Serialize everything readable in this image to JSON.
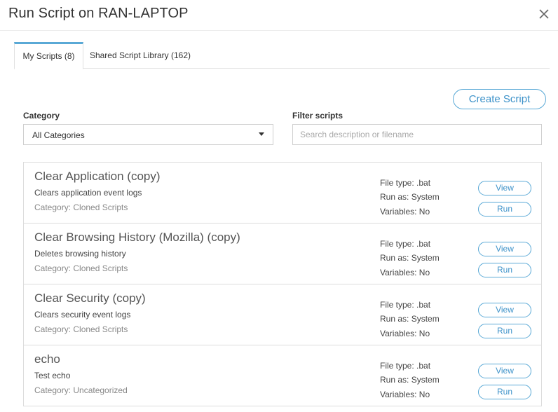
{
  "dialog": {
    "title": "Run Script on RAN-LAPTOP"
  },
  "tabs": [
    {
      "label": "My Scripts (8)",
      "active": true
    },
    {
      "label": "Shared Script Library (162)",
      "active": false
    }
  ],
  "actions": {
    "create_label": "Create Script"
  },
  "filters": {
    "category_label": "Category",
    "category_value": "All Categories",
    "filter_label": "Filter scripts",
    "filter_placeholder": "Search description or filename",
    "filter_value": ""
  },
  "scripts": [
    {
      "name": "Clear Application (copy)",
      "description": "Clears application event logs",
      "category": "Category: Cloned Scripts",
      "file_type": "File type: .bat",
      "run_as": "Run as: System",
      "variables": "Variables: No",
      "view_label": "View",
      "run_label": "Run"
    },
    {
      "name": "Clear Browsing History (Mozilla) (copy)",
      "description": "Deletes browsing history",
      "category": "Category: Cloned Scripts",
      "file_type": "File type: .bat",
      "run_as": "Run as: System",
      "variables": "Variables: No",
      "view_label": "View",
      "run_label": "Run"
    },
    {
      "name": "Clear Security (copy)",
      "description": "Clears security event logs",
      "category": "Category: Cloned Scripts",
      "file_type": "File type: .bat",
      "run_as": "Run as: System",
      "variables": "Variables: No",
      "view_label": "View",
      "run_label": "Run"
    },
    {
      "name": "echo",
      "description": "Test echo",
      "category": "Category: Uncategorized",
      "file_type": "File type: .bat",
      "run_as": "Run as: System",
      "variables": "Variables: No",
      "view_label": "View",
      "run_label": "Run"
    }
  ],
  "colors": {
    "accent": "#5aa9d6",
    "accent_text": "#3d92c9",
    "border": "#dcdcdc"
  }
}
